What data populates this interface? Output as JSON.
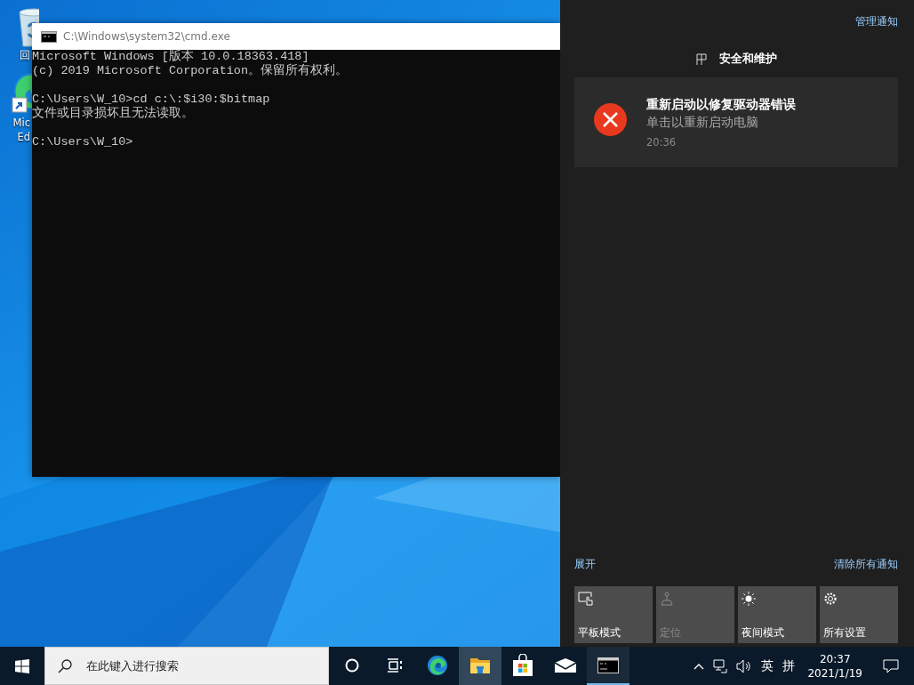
{
  "desktop": {
    "icons": [
      {
        "kind": "recycle-bin",
        "label": "回"
      },
      {
        "kind": "edge",
        "label": "Mic",
        "label_line2": "Ed"
      }
    ]
  },
  "console_window": {
    "title": "C:\\Windows\\system32\\cmd.exe",
    "lines": [
      {
        "text": "Microsoft Windows [版本 10.0.18363.418]",
        "blank_before": false
      },
      {
        "text": "(c) 2019 Microsoft Corporation。保留所有权利。",
        "blank_before": false
      },
      {
        "text": "C:\\Users\\W_10>cd c:\\:$i30:$bitmap",
        "blank_before": true
      },
      {
        "text": "文件或目录损坏且无法读取。",
        "blank_before": false
      },
      {
        "text": "C:\\Users\\W_10>",
        "blank_before": true
      }
    ]
  },
  "action_center": {
    "manage_link": "管理通知",
    "group": {
      "title": "安全和维护"
    },
    "notifications": [
      {
        "title": "重新启动以修复驱动器错误",
        "body": "单击以重新启动电脑",
        "time": "20:36"
      }
    ],
    "expand_link": "展开",
    "clear_link": "清除所有通知",
    "quick_actions": [
      {
        "kind": "tablet",
        "label": "平板模式",
        "disabled": false
      },
      {
        "kind": "location",
        "label": "定位",
        "disabled": true
      },
      {
        "kind": "night",
        "label": "夜间模式",
        "disabled": false
      },
      {
        "kind": "settings",
        "label": "所有设置",
        "disabled": false
      }
    ]
  },
  "taskbar": {
    "search": {
      "placeholder": "在此键入进行搜索"
    },
    "apps": [
      {
        "kind": "cortana",
        "selected": false,
        "running": false
      },
      {
        "kind": "task-view",
        "selected": false,
        "running": false
      },
      {
        "kind": "edge",
        "selected": false,
        "running": false
      },
      {
        "kind": "explorer",
        "selected": true,
        "running": false
      },
      {
        "kind": "store",
        "selected": false,
        "running": false
      },
      {
        "kind": "mail",
        "selected": false,
        "running": false
      },
      {
        "kind": "console",
        "selected": false,
        "running": true
      }
    ],
    "tray": {
      "input_language": "英",
      "input_mode": "拼",
      "time": "20:37",
      "date": "2021/1/19"
    }
  }
}
